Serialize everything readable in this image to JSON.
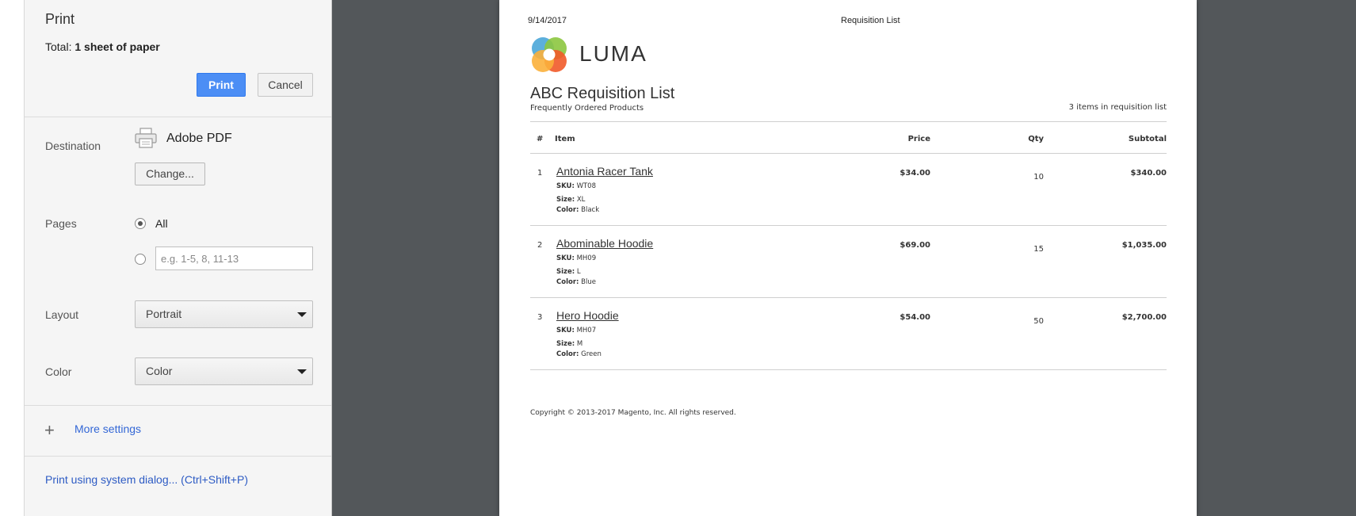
{
  "panel": {
    "title": "Print",
    "total_label": "Total:",
    "total_value": "1 sheet of paper",
    "print_button": "Print",
    "cancel_button": "Cancel",
    "destination_label": "Destination",
    "destination_value": "Adobe PDF",
    "change_button": "Change...",
    "pages_label": "Pages",
    "pages_all_label": "All",
    "pages_placeholder": "e.g. 1-5, 8, 11-13",
    "layout_label": "Layout",
    "layout_value": "Portrait",
    "color_label": "Color",
    "color_value": "Color",
    "more_settings": "More settings",
    "system_dialog": "Print using system dialog... (Ctrl+Shift+P)"
  },
  "preview": {
    "date": "9/14/2017",
    "header_title": "Requisition List",
    "logo_text": "LUMA",
    "list_title": "ABC Requisition List",
    "list_subtitle": "Frequently Ordered Products",
    "items_count": "3 items in requisition list",
    "columns": {
      "num": "#",
      "item": "Item",
      "price": "Price",
      "qty": "Qty",
      "subtotal": "Subtotal"
    },
    "sku_label": "SKU:",
    "size_label": "Size:",
    "color_label": "Color:",
    "rows": [
      {
        "num": "1",
        "name": "Antonia Racer Tank",
        "sku": "WT08",
        "size": "XL",
        "color": "Black",
        "price": "$34.00",
        "qty": "10",
        "subtotal": "$340.00"
      },
      {
        "num": "2",
        "name": "Abominable Hoodie",
        "sku": "MH09",
        "size": "L",
        "color": "Blue",
        "price": "$69.00",
        "qty": "15",
        "subtotal": "$1,035.00"
      },
      {
        "num": "3",
        "name": "Hero Hoodie",
        "sku": "MH07",
        "size": "M",
        "color": "Green",
        "price": "$54.00",
        "qty": "50",
        "subtotal": "$2,700.00"
      }
    ],
    "copyright": "Copyright © 2013-2017 Magento, Inc. All rights reserved."
  },
  "colors": {
    "print_button": "#4c8ef5",
    "link": "#3367d6",
    "preview_background": "#53575a",
    "panel_background": "#f5f5f5"
  }
}
